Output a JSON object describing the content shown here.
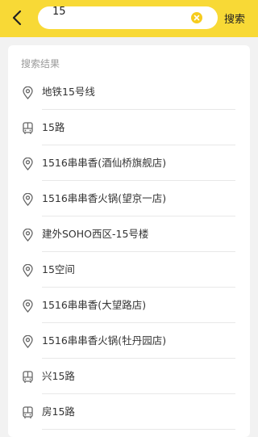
{
  "header": {
    "back_icon": "chevron-left-icon",
    "search_value": "15",
    "search_placeholder": "",
    "clear_icon": "clear-icon",
    "search_button_label": "搜索"
  },
  "results": {
    "title": "搜索结果",
    "items": [
      {
        "label": "地铁15号线",
        "icon": "location-pin-icon"
      },
      {
        "label": "15路",
        "icon": "bus-icon"
      },
      {
        "label": "1516串串香(酒仙桥旗舰店)",
        "icon": "location-pin-icon"
      },
      {
        "label": "1516串串香火锅(望京一店)",
        "icon": "location-pin-icon"
      },
      {
        "label": "建外SOHO西区-15号楼",
        "icon": "location-pin-icon"
      },
      {
        "label": "15空间",
        "icon": "location-pin-icon"
      },
      {
        "label": "1516串串香(大望路店)",
        "icon": "location-pin-icon"
      },
      {
        "label": "1516串串香火锅(牡丹园店)",
        "icon": "location-pin-icon"
      },
      {
        "label": "兴15路",
        "icon": "bus-icon"
      },
      {
        "label": "房15路",
        "icon": "bus-icon"
      }
    ]
  },
  "colors": {
    "header_bg": "#f8d936",
    "clear_button": "#f6cc1e",
    "page_bg": "#f2f2f2"
  }
}
